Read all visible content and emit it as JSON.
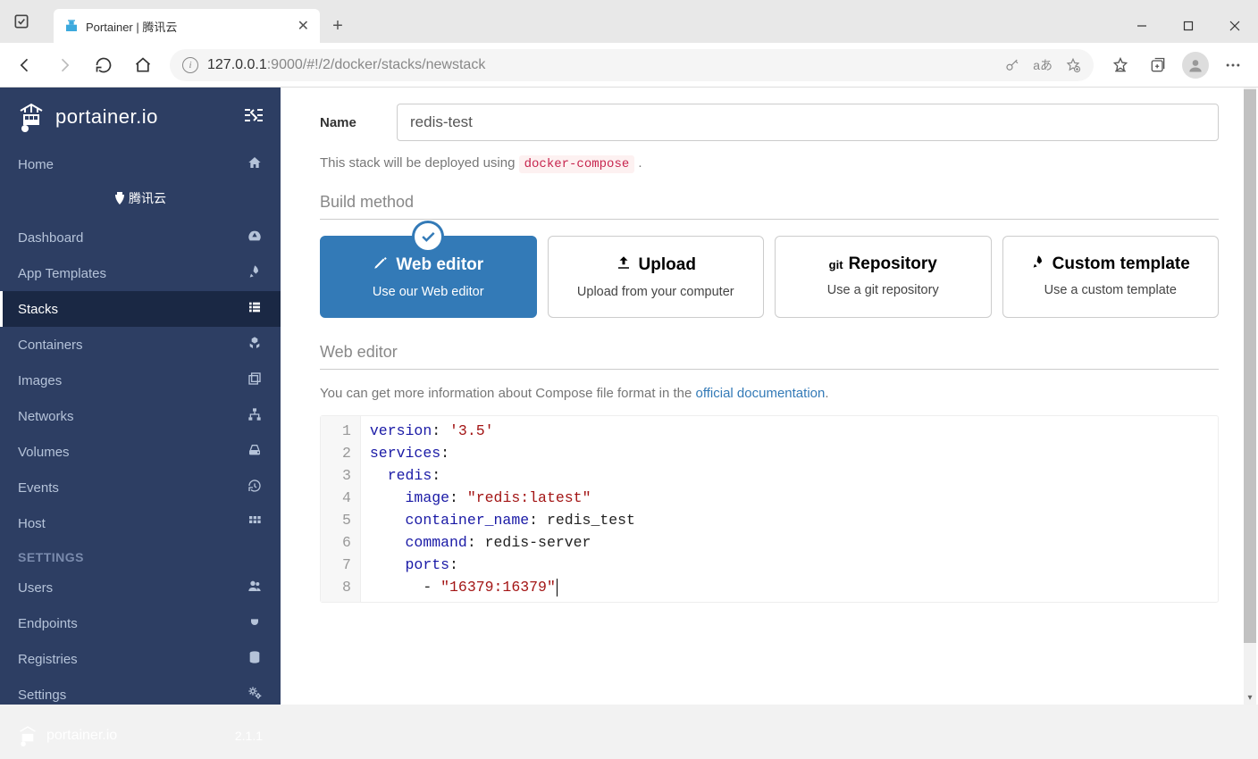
{
  "browser": {
    "tab_title": "Portainer | 腾讯云",
    "url_host_dim": "127.0.0.1",
    "url_port_dim": ":9000",
    "url_path": "/#!/2/docker/stacks/newstack",
    "addr_lang": "aあ"
  },
  "sidebar": {
    "brand": "portainer.io",
    "env_name": "腾讯云",
    "home": "Home",
    "items": [
      {
        "label": "Dashboard",
        "icon": "tachometer"
      },
      {
        "label": "App Templates",
        "icon": "rocket"
      },
      {
        "label": "Stacks",
        "icon": "th-list",
        "active": true
      },
      {
        "label": "Containers",
        "icon": "cubes"
      },
      {
        "label": "Images",
        "icon": "clone"
      },
      {
        "label": "Networks",
        "icon": "sitemap"
      },
      {
        "label": "Volumes",
        "icon": "hdd"
      },
      {
        "label": "Events",
        "icon": "history"
      },
      {
        "label": "Host",
        "icon": "th"
      }
    ],
    "settings_header": "SETTINGS",
    "settings": [
      {
        "label": "Users",
        "icon": "users"
      },
      {
        "label": "Endpoints",
        "icon": "plug"
      },
      {
        "label": "Registries",
        "icon": "database"
      },
      {
        "label": "Settings",
        "icon": "cogs"
      }
    ],
    "footer_brand": "portainer.io",
    "version": "2.1.1"
  },
  "form": {
    "name_label": "Name",
    "name_value": "redis-test",
    "hint_prefix": "This stack will be deployed using ",
    "hint_code": "docker-compose",
    "hint_suffix": "."
  },
  "sections": {
    "build_method": "Build method",
    "web_editor": "Web editor"
  },
  "methods": [
    {
      "title": "Web editor",
      "desc": "Use our Web editor",
      "icon": "pencil",
      "active": true
    },
    {
      "title": "Upload",
      "desc": "Upload from your computer",
      "icon": "upload"
    },
    {
      "title": "Repository",
      "prefix": "git",
      "desc": "Use a git repository",
      "icon": "git"
    },
    {
      "title": "Custom template",
      "desc": "Use a custom template",
      "icon": "rocket"
    }
  ],
  "doc_hint": {
    "prefix": "You can get more information about Compose file format in the ",
    "link": "official documentation",
    "suffix": "."
  },
  "editor": {
    "lines": [
      [
        {
          "t": "key",
          "v": "version"
        },
        {
          "t": "plain",
          "v": ": "
        },
        {
          "t": "str",
          "v": "'3.5'"
        }
      ],
      [
        {
          "t": "key",
          "v": "services"
        },
        {
          "t": "plain",
          "v": ":"
        }
      ],
      [
        {
          "t": "plain",
          "v": "  "
        },
        {
          "t": "key",
          "v": "redis"
        },
        {
          "t": "plain",
          "v": ":"
        }
      ],
      [
        {
          "t": "plain",
          "v": "    "
        },
        {
          "t": "key",
          "v": "image"
        },
        {
          "t": "plain",
          "v": ": "
        },
        {
          "t": "str",
          "v": "\"redis:latest\""
        }
      ],
      [
        {
          "t": "plain",
          "v": "    "
        },
        {
          "t": "key",
          "v": "container_name"
        },
        {
          "t": "plain",
          "v": ": redis_test"
        }
      ],
      [
        {
          "t": "plain",
          "v": "    "
        },
        {
          "t": "key",
          "v": "command"
        },
        {
          "t": "plain",
          "v": ": redis-server"
        }
      ],
      [
        {
          "t": "plain",
          "v": "    "
        },
        {
          "t": "key",
          "v": "ports"
        },
        {
          "t": "plain",
          "v": ":"
        }
      ],
      [
        {
          "t": "plain",
          "v": "      - "
        },
        {
          "t": "str",
          "v": "\"16379:16379\""
        }
      ]
    ]
  }
}
